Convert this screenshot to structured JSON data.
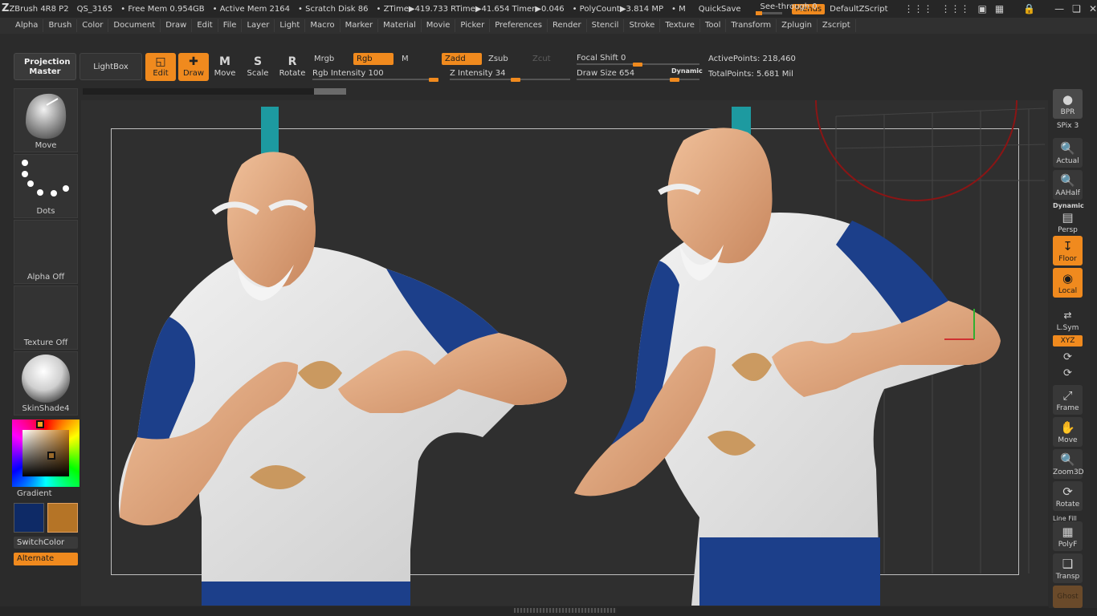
{
  "titlebar": {
    "app": "ZBrush 4R8 P2",
    "doc": "QS_3165",
    "free_mem": "• Free Mem 0.954GB",
    "active_mem": "• Active Mem 2164",
    "scratch": "• Scratch Disk 86",
    "ztime": "• ZTime▶419.733 RTime▶41.654 Timer▶0.046",
    "polycount": "• PolyCount▶3.814 MP",
    "m": "• M",
    "quicksave": "QuickSave",
    "seethrough": "See-through   0",
    "menus": "Menus",
    "zscript": "DefaultZScript"
  },
  "menubar": [
    "Alpha",
    "Brush",
    "Color",
    "Document",
    "Draw",
    "Edit",
    "File",
    "Layer",
    "Light",
    "Macro",
    "Marker",
    "Material",
    "Movie",
    "Picker",
    "Preferences",
    "Render",
    "Stencil",
    "Stroke",
    "Texture",
    "Tool",
    "Transform",
    "Zplugin",
    "Zscript"
  ],
  "shelf": {
    "projection_master": "Projection Master",
    "lightbox": "LightBox",
    "edit": "Edit",
    "draw": "Draw",
    "move": "Move",
    "scale": "Scale",
    "rotate": "Rotate",
    "mrgb": "Mrgb",
    "rgb": "Rgb",
    "m": "M",
    "zadd": "Zadd",
    "zsub": "Zsub",
    "zcut": "Zcut",
    "rgb_intensity": "Rgb Intensity 100",
    "z_intensity": "Z Intensity 34",
    "focal_shift": "Focal Shift 0",
    "draw_size": "Draw Size 654",
    "dynamic": "Dynamic",
    "active_points": "ActivePoints: 218,460",
    "total_points": "TotalPoints: 5.681 Mil"
  },
  "left_tray": {
    "brush": "Move",
    "stroke": "Dots",
    "alpha": "Alpha Off",
    "texture": "Texture Off",
    "material": "SkinShade4",
    "gradient": "Gradient",
    "switch_color": "SwitchColor",
    "alternate": "Alternate"
  },
  "colors": {
    "accent": "#f08a1e",
    "main_color": "#0e2a66",
    "secondary_color": "#b57426"
  },
  "right_tray": {
    "bpr": "BPR",
    "spix": "SPix 3",
    "actual": "Actual",
    "aahalf": "AAHalf",
    "dynamic": "Dynamic",
    "persp": "Persp",
    "floor": "Floor",
    "local": "Local",
    "lsym": "L.Sym",
    "xyz": "XYZ",
    "frame": "Frame",
    "move": "Move",
    "zoom3d": "Zoom3D",
    "rotate": "Rotate",
    "line_fill": "Line Fill",
    "polyf": "PolyF",
    "transp": "Transp",
    "ghost": "Ghost"
  }
}
